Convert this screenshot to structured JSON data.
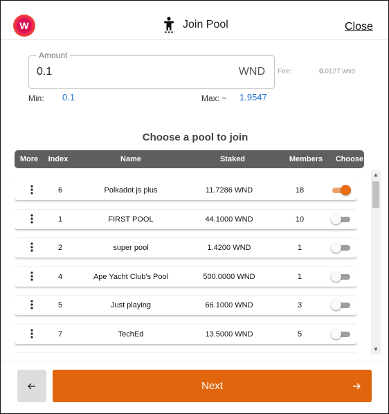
{
  "header": {
    "logo_letter": "W",
    "title": "Join Pool",
    "close_label": "Close",
    "title_icon": "person-pool-icon"
  },
  "amount": {
    "label": "Amount",
    "value": "0.1",
    "unit": "WND",
    "fee_label": "Fee:",
    "fee_value_bold": "0.",
    "fee_value_rest": "0127",
    "fee_unit": "WND"
  },
  "limits": {
    "min_label": "Min:",
    "min_value": "0.1",
    "max_label": "Max: ~",
    "max_value": "1.9547"
  },
  "section_title": "Choose a pool to join",
  "table": {
    "headers": [
      "More",
      "Index",
      "Name",
      "Staked",
      "Members",
      "Choose"
    ],
    "rows": [
      {
        "index": "6",
        "name": "Polkadot js plus",
        "staked": "11.7286 WND",
        "members": "18",
        "chosen": true
      },
      {
        "index": "1",
        "name": "FIRST POOL",
        "staked": "44.1000 WND",
        "members": "10",
        "chosen": false
      },
      {
        "index": "2",
        "name": "super pool",
        "staked": "1.4200 WND",
        "members": "1",
        "chosen": false
      },
      {
        "index": "4",
        "name": "Ape Yacht Club's Pool",
        "staked": "500.0000 WND",
        "members": "1",
        "chosen": false
      },
      {
        "index": "5",
        "name": "Just playing",
        "staked": "66.1000 WND",
        "members": "3",
        "chosen": false
      },
      {
        "index": "7",
        "name": "TechEd",
        "staked": "13.5000 WND",
        "members": "5",
        "chosen": false
      }
    ]
  },
  "footer": {
    "back_icon": "arrow-left-icon",
    "next_label": "Next",
    "next_icon": "arrow-right-icon"
  },
  "colors": {
    "accent": "#e0650d",
    "link_blue": "#1e6fd0",
    "table_header": "#5f5f5f"
  }
}
